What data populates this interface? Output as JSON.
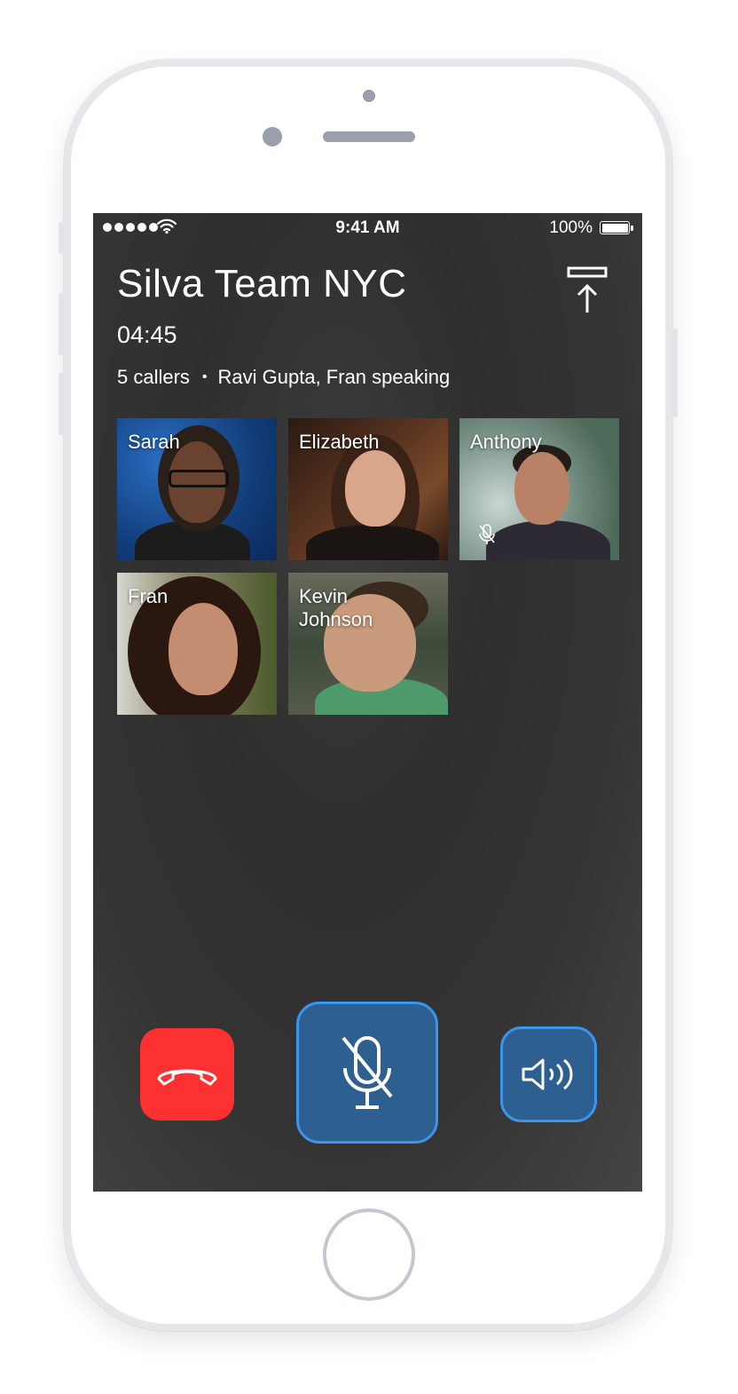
{
  "status_bar": {
    "signal_icon": "signal-dots-icon",
    "wifi_icon": "wifi-icon",
    "time": "9:41 AM",
    "battery_percent": "100%",
    "battery_icon": "battery-icon"
  },
  "call": {
    "title": "Silva Team NYC",
    "duration": "04:45",
    "caller_count": "5 callers",
    "separator": "•",
    "speaking": "Ravi Gupta, Fran speaking",
    "share_icon": "share-upload-icon"
  },
  "participants": [
    {
      "name": "Sarah",
      "muted": false
    },
    {
      "name": "Elizabeth",
      "muted": false
    },
    {
      "name": "Anthony",
      "muted": true
    },
    {
      "name": "Fran",
      "muted": false
    },
    {
      "name": "Kevin Johnson",
      "muted": false
    }
  ],
  "controls": {
    "end_call_icon": "hang-up-icon",
    "mute_icon": "microphone-off-icon",
    "speaker_icon": "speaker-icon",
    "end_color": "#FD3032",
    "active_color": "#2D5F91",
    "active_border": "#3A94F0"
  }
}
